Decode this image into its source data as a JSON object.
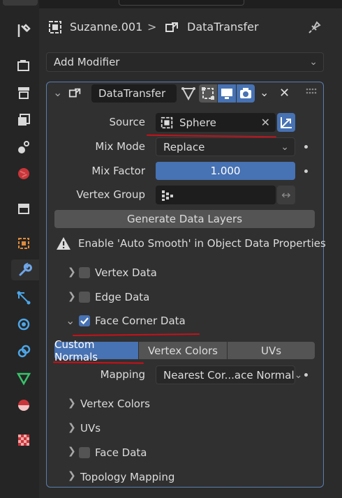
{
  "breadcrumb": {
    "object": "Suzanne.001",
    "separator": ">",
    "modifier": "DataTransfer"
  },
  "add_modifier": "Add Modifier",
  "modifier": {
    "name": "DataTransfer",
    "source": {
      "label": "Source",
      "value": "Sphere"
    },
    "mix_mode": {
      "label": "Mix Mode",
      "value": "Replace"
    },
    "mix_factor": {
      "label": "Mix Factor",
      "value": "1.000",
      "fraction": 1.0
    },
    "vertex_group": {
      "label": "Vertex Group",
      "value": ""
    },
    "generate_button": "Generate Data Layers",
    "warning": "Enable 'Auto Smooth' in Object Data Properties",
    "sections": {
      "vertex_data": "Vertex Data",
      "edge_data": "Edge Data",
      "face_corner_data": "Face Corner Data"
    },
    "tabs": [
      "Custom Normals",
      "Vertex Colors",
      "UVs"
    ],
    "mapping": {
      "label": "Mapping",
      "value": "Nearest Cor...ace Normal"
    },
    "subsections": {
      "vertex_colors": "Vertex Colors",
      "uvs": "UVs",
      "face_data": "Face Data",
      "topology_mapping": "Topology Mapping"
    }
  },
  "colors": {
    "accent": "#4772b3",
    "annotation": "#c8111a",
    "panel_border": "#5a7eb0"
  }
}
